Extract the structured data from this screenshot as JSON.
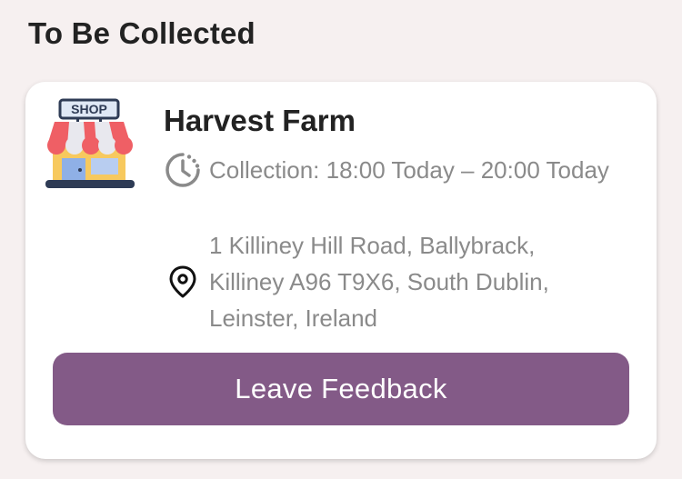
{
  "section": {
    "title": "To Be Collected"
  },
  "order": {
    "store_name": "Harvest Farm",
    "shop_sign": "SHOP",
    "collection_text": "Collection: 18:00 Today – 20:00 Today",
    "address_text": "1 Killiney Hill Road, Ballybrack, Killiney A96 T9X6, South Dublin, Leinster, Ireland",
    "feedback_label": "Leave Feedback"
  },
  "icons": {
    "shop": "shop-storefront-icon",
    "time": "clock-timer-icon",
    "location": "location-pin-icon"
  },
  "colors": {
    "background": "#f6f0f0",
    "card": "#ffffff",
    "button": "#835a87",
    "muted_text": "#8a8a8a",
    "title_text": "#222222"
  }
}
